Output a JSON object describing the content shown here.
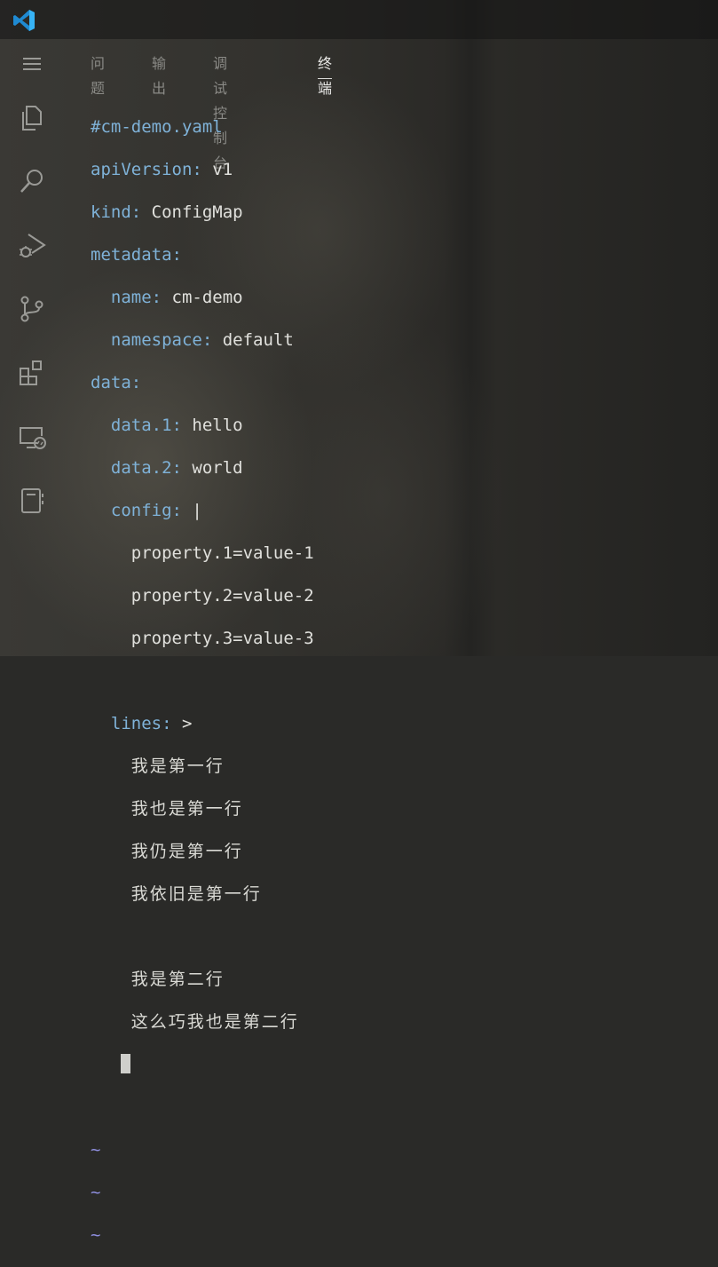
{
  "app": {
    "logo": "vscode-logo"
  },
  "activity_bar": {
    "items": [
      {
        "icon": "menu-icon"
      },
      {
        "icon": "explorer-icon"
      },
      {
        "icon": "search-icon"
      },
      {
        "icon": "run-debug-icon"
      },
      {
        "icon": "source-control-icon"
      },
      {
        "icon": "extensions-icon"
      },
      {
        "icon": "remote-explorer-icon"
      },
      {
        "icon": "notebook-icon"
      }
    ]
  },
  "panel": {
    "tabs": [
      {
        "label": "问题",
        "active": false
      },
      {
        "label": "输出",
        "active": false
      },
      {
        "label": "调试控制台",
        "active": false
      },
      {
        "label": "终端",
        "active": true
      }
    ]
  },
  "terminal": {
    "comment": "#cm-demo.yaml",
    "api_key": "apiVersion:",
    "api_val": "v1",
    "kind_key": "kind:",
    "kind_val": "ConfigMap",
    "metadata_key": "metadata:",
    "name_key": "name:",
    "name_val": "cm-demo",
    "ns_key": "namespace:",
    "ns_val": "default",
    "data_key": "data:",
    "d1_key": "data.1:",
    "d1_val": "hello",
    "d2_key": "data.2:",
    "d2_val": "world",
    "config_key": "config:",
    "config_val": "|",
    "prop1": "property.1=value-1",
    "prop2": "property.2=value-2",
    "prop3": "property.3=value-3",
    "lines_key": "lines:",
    "lines_val": ">",
    "cjk1": "我是第一行",
    "cjk2": "我也是第一行",
    "cjk3": "我仍是第一行",
    "cjk4": "我依旧是第一行",
    "cjk5": "我是第二行",
    "cjk6": "这么巧我也是第二行",
    "tilde": "~"
  },
  "colors": {
    "key": "#7fb2d8",
    "value": "#e0e0dc",
    "tilde": "#8f8fe0",
    "accent_logo": "#23a9f2"
  }
}
